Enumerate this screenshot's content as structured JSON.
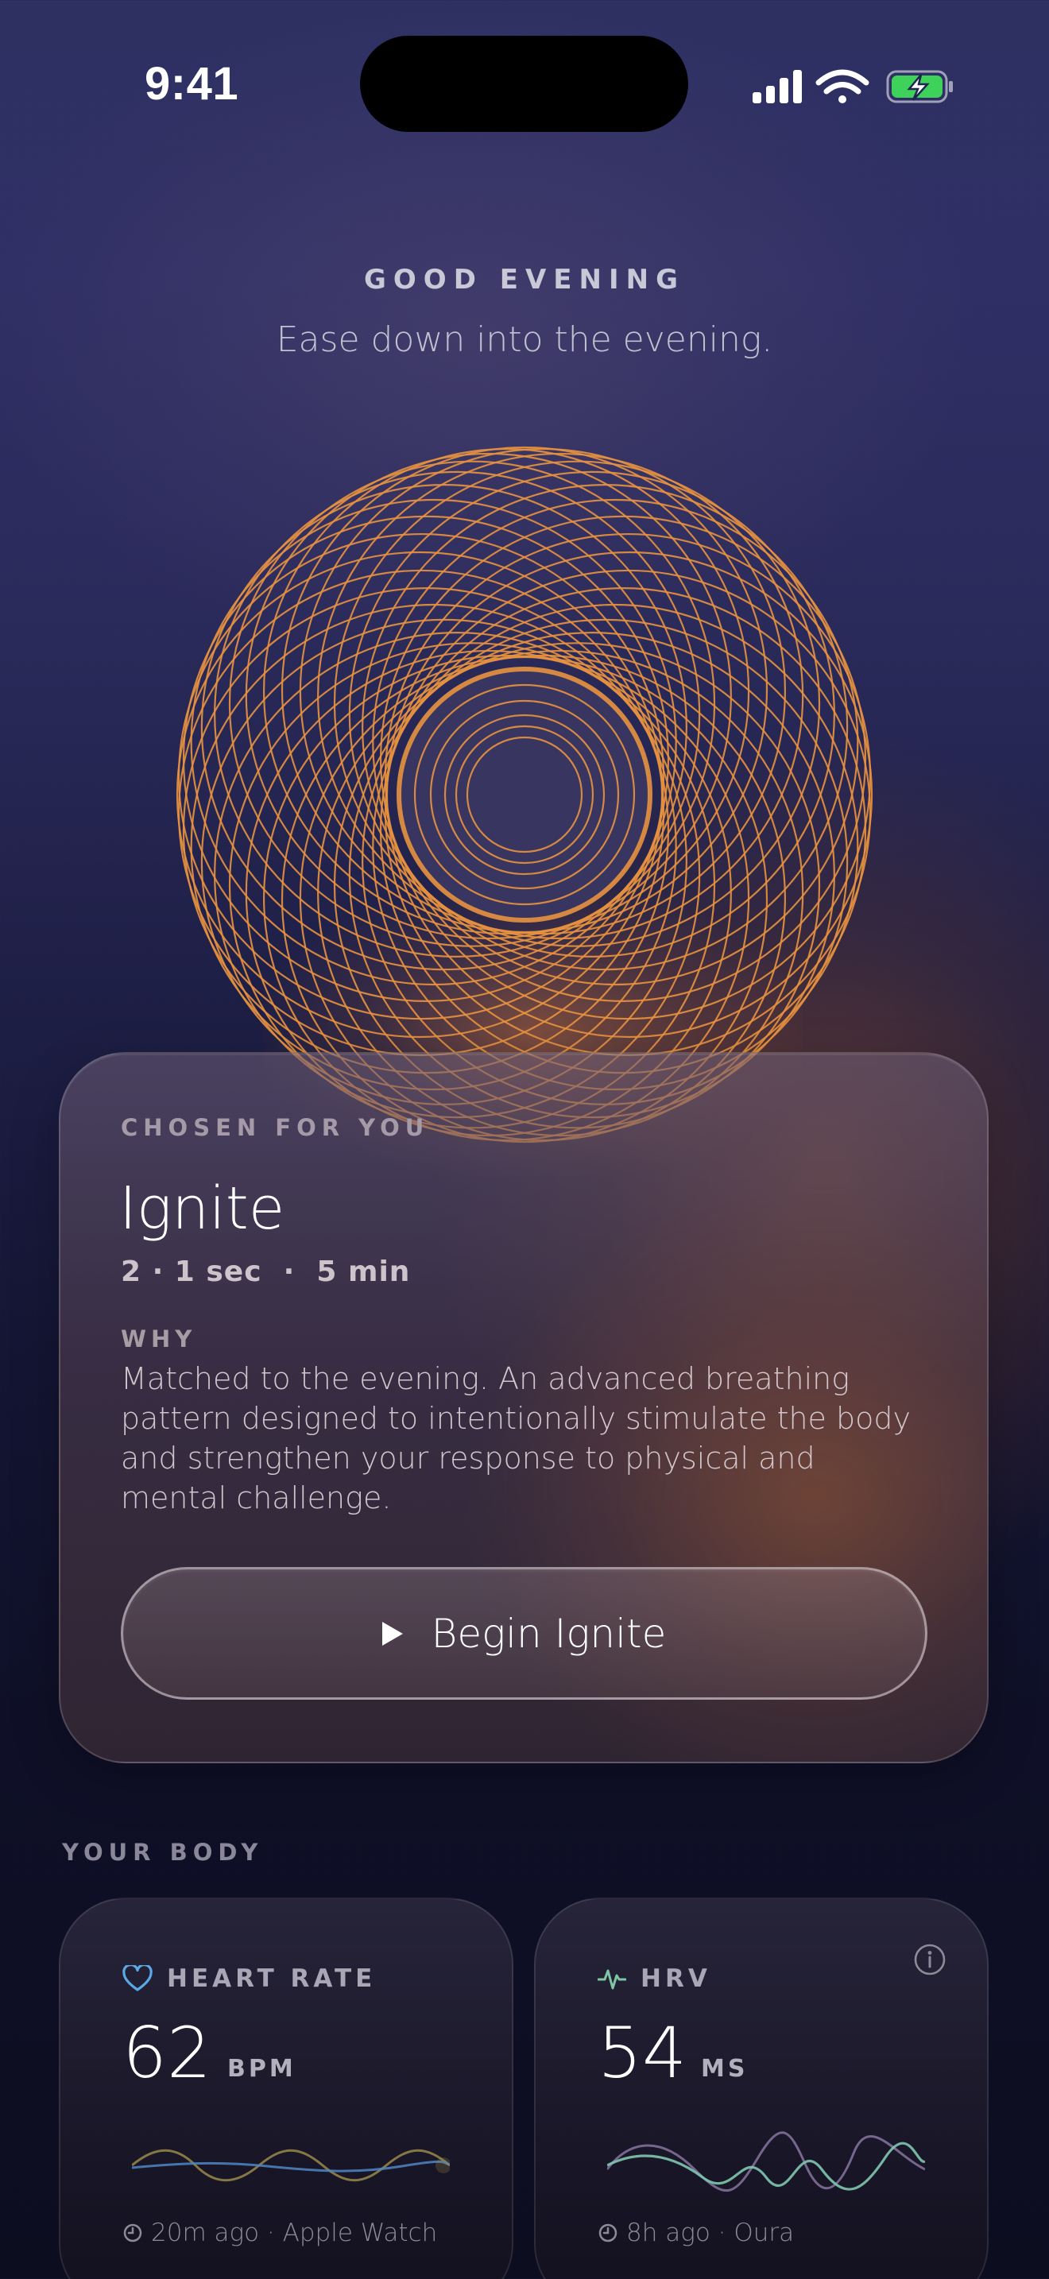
{
  "status_bar": {
    "time": "9:41"
  },
  "greeting": {
    "eyebrow": "GOOD EVENING",
    "subtitle": "Ease down into the evening."
  },
  "recommendation": {
    "eyebrow": "CHOSEN FOR YOU",
    "title": "Ignite",
    "meta": "2 · 1 sec  ·  5 min",
    "why_label": "WHY",
    "why_text": "Matched to the evening. An advanced breathing pattern designed to intentionally stimulate the body and strengthen your response to physical and mental challenge.",
    "button_label": "Begin Ignite",
    "accent_color": "#e8923f"
  },
  "your_body": {
    "label": "YOUR BODY",
    "metrics": [
      {
        "name": "HEART RATE",
        "value": "62",
        "unit": "BPM",
        "updated": "20m ago",
        "source": "Apple Watch",
        "icon": "heart-icon",
        "icon_color": "#5aa9e6"
      },
      {
        "name": "HRV",
        "value": "54",
        "unit": "MS",
        "updated": "8h ago",
        "source": "Oura",
        "icon": "pulse-icon",
        "icon_color": "#7fc6a4"
      }
    ]
  }
}
